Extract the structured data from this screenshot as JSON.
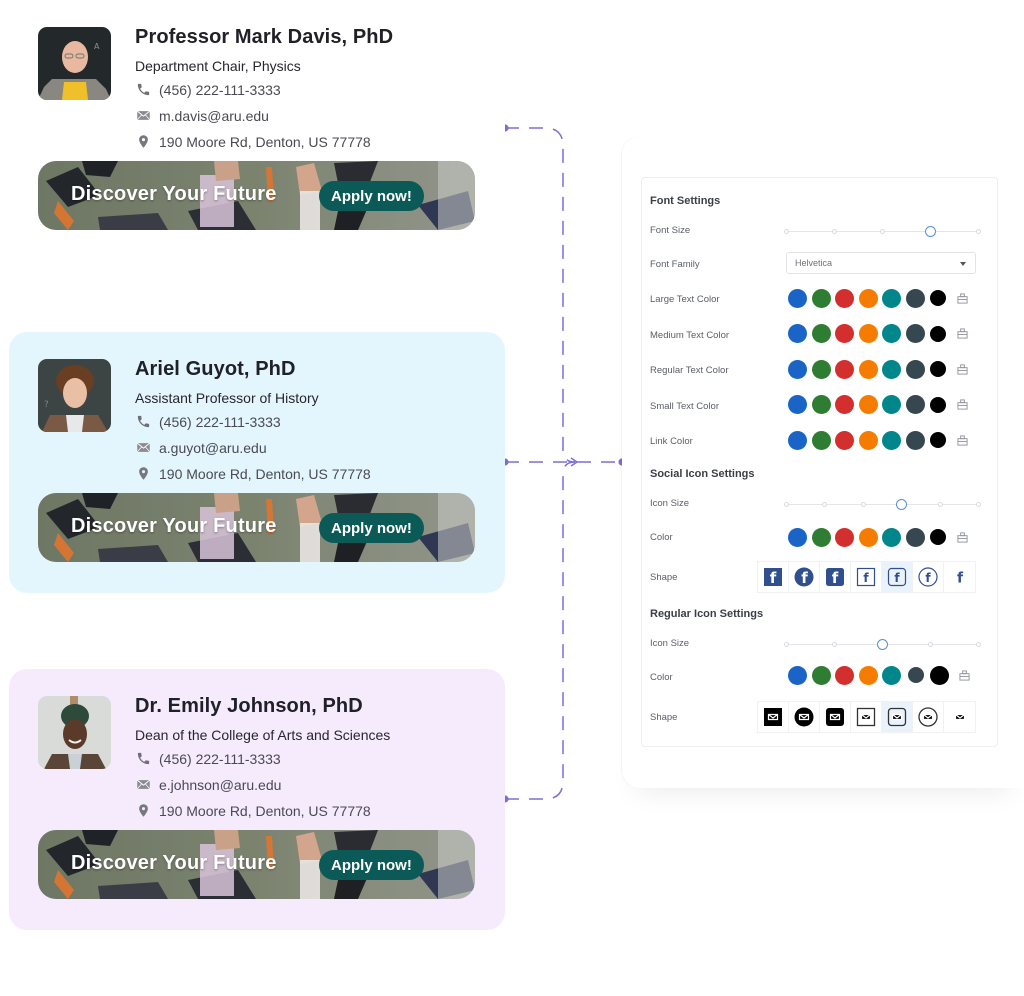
{
  "cards": [
    {
      "name": "Professor Mark Davis, PhD",
      "role": "Department Chair, Physics",
      "phone": "(456) 222-111-3333",
      "email": "m.davis@aru.edu",
      "address": "190 Moore Rd, Denton, US 77778",
      "banner_text": "Discover Your Future",
      "cta_label": "Apply now!",
      "background": "#ffffff"
    },
    {
      "name": "Ariel Guyot, PhD",
      "role": "Assistant Professor of History",
      "phone": "(456) 222-111-3333",
      "email": "a.guyot@aru.edu",
      "address": "190 Moore Rd, Denton, US 77778",
      "banner_text": "Discover Your Future",
      "cta_label": "Apply now!",
      "background": "#e4f6fd"
    },
    {
      "name": "Dr. Emily Johnson, PhD",
      "role": "Dean of the College of Arts and Sciences",
      "phone": "(456) 222-111-3333",
      "email": "e.johnson@aru.edu",
      "address": "190 Moore Rd, Denton, US 77778",
      "banner_text": "Discover Your Future",
      "cta_label": "Apply now!",
      "background": "#f5ebfd"
    }
  ],
  "icons": {
    "phone": "phone-icon",
    "email": "envelope-icon",
    "address": "map-pin-icon",
    "color_picker": "color-picker-icon"
  },
  "palette": [
    "#1a64c8",
    "#2e7d32",
    "#d32f2f",
    "#f57c00",
    "#00868b",
    "#37474f",
    "#000000"
  ],
  "connector_color": "#7b6fd6",
  "cta_color": "#0b5a57",
  "settings": {
    "font_settings": {
      "title": "Font Settings",
      "font_size": {
        "label": "Font Size",
        "stops": 5,
        "selected_index": 3
      },
      "font_family": {
        "label": "Font Family",
        "value": "Helvetica"
      },
      "color_rows": [
        {
          "label": "Large Text Color"
        },
        {
          "label": "Medium Text Color"
        },
        {
          "label": "Regular Text Color"
        },
        {
          "label": "Small Text Color"
        },
        {
          "label": "Link Color"
        }
      ]
    },
    "social_icon_settings": {
      "title": "Social Icon Settings",
      "icon_size": {
        "label": "Icon Size",
        "stops": 6,
        "selected_index": 3
      },
      "color": {
        "label": "Color"
      },
      "shape": {
        "label": "Shape",
        "options": [
          "filled-square",
          "filled-circle",
          "filled-rounded",
          "outline-square",
          "outline-rounded",
          "outline-circle",
          "plain"
        ],
        "selected_index": 4
      }
    },
    "regular_icon_settings": {
      "title": "Regular Icon Settings",
      "icon_size": {
        "label": "Icon Size",
        "stops": 5,
        "selected_index": 2
      },
      "color": {
        "label": "Color",
        "selected_index": 6
      },
      "shape": {
        "label": "Shape",
        "options": [
          "filled-square",
          "filled-circle",
          "filled-rounded",
          "outline-square",
          "outline-rounded",
          "outline-circle",
          "plain"
        ],
        "selected_index": 4
      }
    }
  }
}
